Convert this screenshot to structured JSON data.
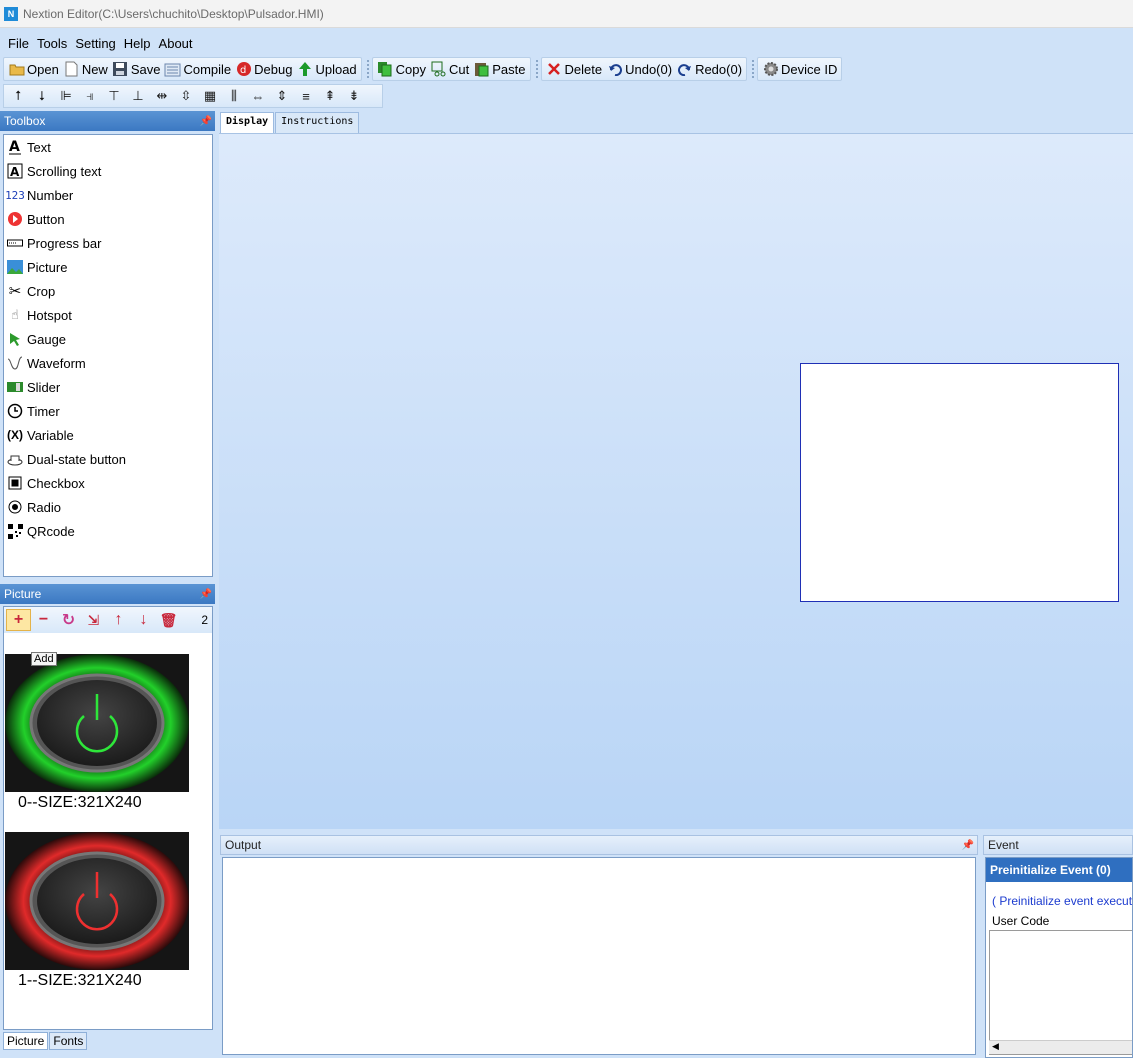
{
  "window": {
    "title": "Nextion Editor(C:\\Users\\chuchito\\Desktop\\Pulsador.HMI)",
    "icon": "nextion-app-icon"
  },
  "menu": [
    "File",
    "Tools",
    "Setting",
    "Help",
    "About"
  ],
  "toolbar": {
    "open": "Open",
    "new": "New",
    "save": "Save",
    "compile": "Compile",
    "debug": "Debug",
    "upload": "Upload",
    "copy": "Copy",
    "cut": "Cut",
    "paste": "Paste",
    "delete": "Delete",
    "undo": "Undo(0)",
    "redo": "Redo(0)",
    "device_id": "Device  ID"
  },
  "toolbox": {
    "title": "Toolbox",
    "items": [
      {
        "label": "Text",
        "icon": "text-icon"
      },
      {
        "label": "Scrolling text",
        "icon": "scrolling-text-icon"
      },
      {
        "label": "Number",
        "icon": "number-icon"
      },
      {
        "label": "Button",
        "icon": "button-icon"
      },
      {
        "label": "Progress bar",
        "icon": "progress-bar-icon"
      },
      {
        "label": "Picture",
        "icon": "picture-icon"
      },
      {
        "label": "Crop",
        "icon": "crop-icon"
      },
      {
        "label": "Hotspot",
        "icon": "hotspot-icon"
      },
      {
        "label": "Gauge",
        "icon": "gauge-icon"
      },
      {
        "label": "Waveform",
        "icon": "waveform-icon"
      },
      {
        "label": "Slider",
        "icon": "slider-icon"
      },
      {
        "label": "Timer",
        "icon": "timer-icon"
      },
      {
        "label": "Variable",
        "icon": "variable-icon"
      },
      {
        "label": "Dual-state button",
        "icon": "dual-state-button-icon"
      },
      {
        "label": "Checkbox",
        "icon": "checkbox-icon"
      },
      {
        "label": "Radio",
        "icon": "radio-icon"
      },
      {
        "label": "QRcode",
        "icon": "qrcode-icon"
      }
    ]
  },
  "picture_panel": {
    "title": "Picture",
    "count": "2",
    "tooltip": "Add",
    "images": [
      {
        "label": "0--SIZE:321X240",
        "ring_color": "#22d02a"
      },
      {
        "label": "1--SIZE:321X240",
        "ring_color": "#e02a2a"
      }
    ],
    "tabs": [
      "Picture",
      "Fonts"
    ]
  },
  "doc_tabs": [
    "Display",
    "Instructions"
  ],
  "output": {
    "title": "Output"
  },
  "event": {
    "title": "Event",
    "tab": "Preinitialize Event (0)",
    "note": "( Preinitialize event execute be",
    "user_code_label": "User Code"
  },
  "colors": {
    "page_border": "#1f2fb5",
    "header_blue": "#3b78c2"
  }
}
